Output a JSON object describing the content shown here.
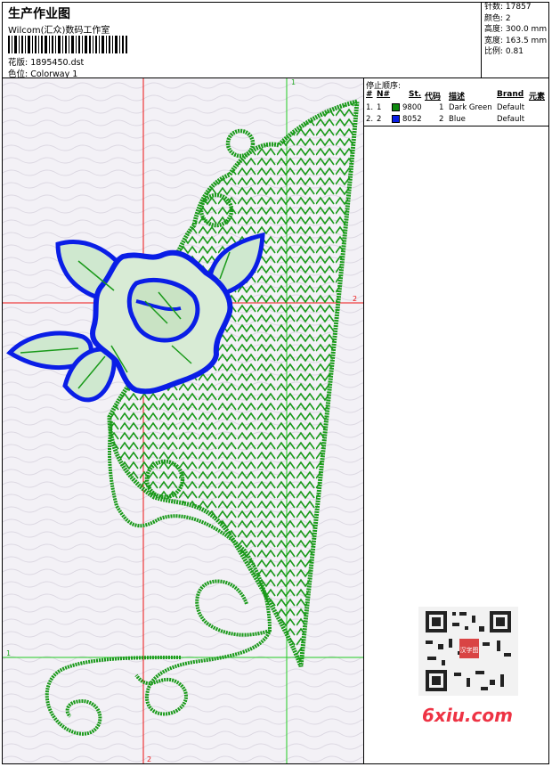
{
  "header": {
    "title": "生产作业图",
    "company": "Wilcom(汇众)数码工作室",
    "design_label": "花版:",
    "design_value": "1895450.dst",
    "colorway_label": "色位:",
    "colorway_value": "Colorway 1"
  },
  "stats": [
    {
      "label": "针数:",
      "value": "17857"
    },
    {
      "label": "颜色:",
      "value": "2"
    },
    {
      "label": "高度:",
      "value": "300.0 mm"
    },
    {
      "label": "宽度:",
      "value": "163.5 mm"
    },
    {
      "label": "比例:",
      "value": "0.81"
    }
  ],
  "stop_sequence": {
    "title": "停止顺序:",
    "columns": [
      "#",
      "N#",
      "St.",
      "代码",
      "描述",
      "Brand",
      "元素"
    ],
    "rows": [
      {
        "idx": "1.",
        "n": "1",
        "st": "9800",
        "code": "1",
        "desc": "Dark Green",
        "brand": "Default",
        "color": "#0f8a0f"
      },
      {
        "idx": "2.",
        "n": "2",
        "st": "8052",
        "code": "2",
        "desc": "Blue",
        "brand": "Default",
        "color": "#0a1ee6"
      }
    ]
  },
  "canvas": {
    "guide_labels": {
      "green_top": "1",
      "green_left": "1",
      "red_right": "2",
      "red_bottom": "2"
    },
    "thread_colors": {
      "green": "#1a9a1a",
      "blue": "#0a1ee6",
      "red_guide": "#ee1111",
      "green_guide": "#22cc22"
    }
  },
  "watermark": {
    "text": "6xiu.com",
    "seal": "汉字图"
  }
}
